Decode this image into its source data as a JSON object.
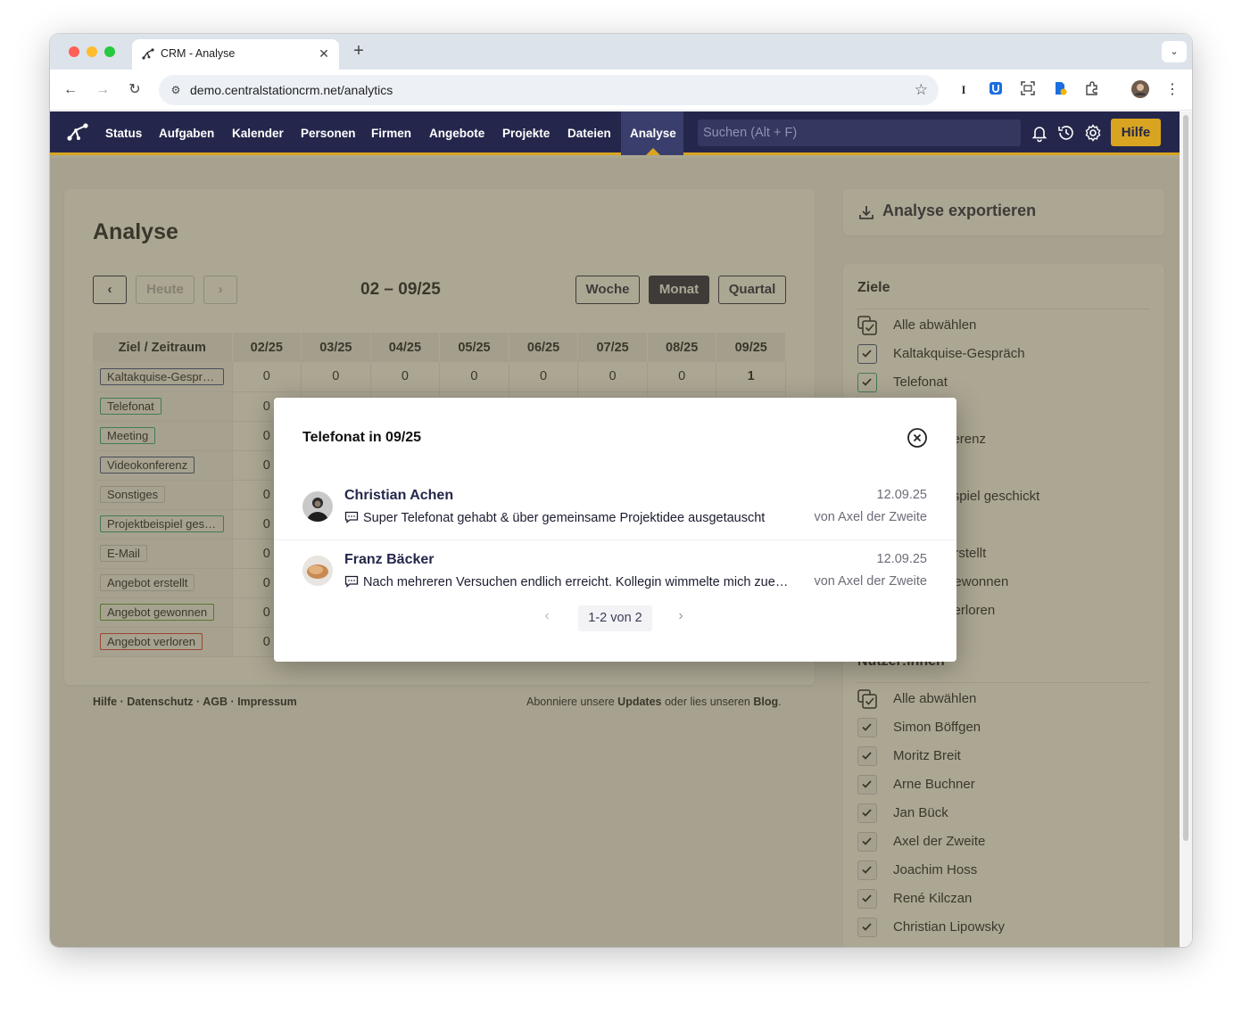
{
  "browser": {
    "tab_title": "CRM - Analyse",
    "url": "demo.centralstationcrm.net/analytics"
  },
  "nav": {
    "items": [
      "Status",
      "Aufgaben",
      "Kalender",
      "Personen",
      "Firmen",
      "Angebote",
      "Projekte",
      "Dateien",
      "Analyse"
    ],
    "active": "Analyse",
    "search_placeholder": "Suchen (Alt + F)",
    "help_label": "Hilfe"
  },
  "main": {
    "title": "Analyse",
    "today_label": "Heute",
    "range_label": "02 – 09/25",
    "views": [
      "Woche",
      "Monat",
      "Quartal"
    ],
    "active_view": "Monat",
    "table": {
      "corner_header": "Ziel / Zeitraum",
      "columns": [
        "02/25",
        "03/25",
        "04/25",
        "05/25",
        "06/25",
        "07/25",
        "08/25",
        "09/25"
      ],
      "rows": [
        {
          "label": "Kaltakquise-Gespräch",
          "color": "#3b4a8c",
          "values": [
            "0",
            "0",
            "0",
            "0",
            "0",
            "0",
            "0",
            "1"
          ]
        },
        {
          "label": "Telefonat",
          "color": "#2aa58a",
          "values": [
            "0",
            "",
            "",
            "",
            "",
            "",
            "",
            ""
          ]
        },
        {
          "label": "Meeting",
          "color": "#2aa58a",
          "values": [
            "0",
            "",
            "",
            "",
            "",
            "",
            "",
            ""
          ]
        },
        {
          "label": "Videokonferenz",
          "color": "#3b4a8c",
          "values": [
            "0",
            "",
            "",
            "",
            "",
            "",
            "",
            ""
          ]
        },
        {
          "label": "Sonstiges",
          "color": "#c8c9d2",
          "values": [
            "0",
            "",
            "",
            "",
            "",
            "",
            "",
            ""
          ]
        },
        {
          "label": "Projektbeispiel geschickt",
          "color": "#2aa58a",
          "values": [
            "0",
            "",
            "",
            "",
            "",
            "",
            "",
            ""
          ]
        },
        {
          "label": "E-Mail",
          "color": "#c8c9d2",
          "values": [
            "0",
            "",
            "",
            "",
            "",
            "",
            "",
            ""
          ]
        },
        {
          "label": "Angebot erstellt",
          "color": "#c8c9d2",
          "values": [
            "0",
            "",
            "",
            "",
            "",
            "",
            "",
            ""
          ]
        },
        {
          "label": "Angebot gewonnen",
          "color": "#5a9a3c",
          "values": [
            "0",
            "",
            "",
            "",
            "",
            "",
            "",
            ""
          ]
        },
        {
          "label": "Angebot verloren",
          "color": "#d93a3a",
          "values": [
            "0",
            "",
            "",
            "",
            "",
            "",
            "",
            ""
          ]
        }
      ]
    }
  },
  "footer": {
    "links": [
      "Hilfe",
      "Datenschutz",
      "AGB",
      "Impressum"
    ],
    "right_prefix": "Abonniere unsere",
    "right_updates": "Updates",
    "right_mid": "oder lies unseren",
    "right_blog": "Blog",
    "right_suffix": "."
  },
  "sidebar": {
    "export_label": "Analyse exportieren",
    "goals_heading": "Ziele",
    "goals": [
      {
        "label": "Alle abwählen",
        "kind": "all"
      },
      {
        "label": "Kaltakquise-Gespräch",
        "color": "#3b4a8c"
      },
      {
        "label": "Telefonat",
        "color": "#2aa58a"
      },
      {
        "label": "Meeting",
        "color": "#2aa58a"
      },
      {
        "label": "Videokonferenz",
        "color": "#3b4a8c"
      },
      {
        "label": "Sonstiges",
        "color": "#c8c9d2"
      },
      {
        "label": "Projektbeispiel geschickt",
        "color": "#2aa58a"
      },
      {
        "label": "E-Mail",
        "color": "#c8c9d2"
      },
      {
        "label": "Angebot erstellt",
        "color": "#c8c9d2"
      },
      {
        "label": "Angebot gewonnen",
        "color": "#5a9a3c"
      },
      {
        "label": "Angebot verloren",
        "color": "#d93a3a"
      }
    ],
    "users_heading": "Nutzer:innen",
    "users": [
      {
        "label": "Alle abwählen",
        "kind": "all"
      },
      {
        "label": "Simon Böffgen"
      },
      {
        "label": "Moritz Breit"
      },
      {
        "label": "Arne Buchner"
      },
      {
        "label": "Jan Bück"
      },
      {
        "label": "Axel der Zweite"
      },
      {
        "label": "Joachim Hoss"
      },
      {
        "label": "René Kilczan"
      },
      {
        "label": "Christian Lipowsky"
      }
    ]
  },
  "modal": {
    "title": "Telefonat in 09/25",
    "entries": [
      {
        "name": "Christian Achen",
        "text": "Super Telefonat gehabt & über gemeinsame Projektidee ausgetauscht",
        "date": "12.09.25",
        "by": "von Axel der Zweite"
      },
      {
        "name": "Franz Bäcker",
        "text": "Nach mehreren Versuchen endlich erreicht. Kollegin wimmelte mich zuerst ab",
        "date": "12.09.25",
        "by": "von Axel der Zweite"
      }
    ],
    "pager_label": "1-2 von 2"
  },
  "colors": {
    "navbar": "#24274b",
    "accent": "#d9a520"
  }
}
